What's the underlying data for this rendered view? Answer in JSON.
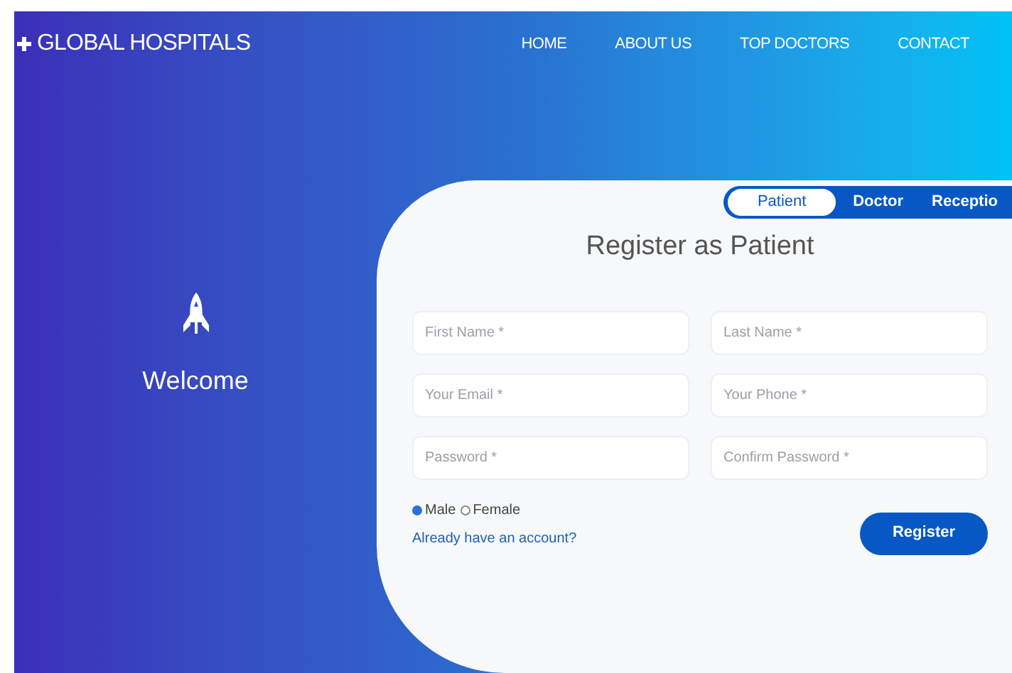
{
  "brand": "GLOBAL HOSPITALS",
  "nav": [
    {
      "label": "HOME"
    },
    {
      "label": "ABOUT US"
    },
    {
      "label": "TOP DOCTORS"
    },
    {
      "label": "CONTACT"
    }
  ],
  "welcome": "Welcome",
  "tabs": [
    {
      "label": "Patient",
      "selected": true
    },
    {
      "label": "Doctor",
      "selected": false
    },
    {
      "label": "Receptio",
      "selected": false
    }
  ],
  "form_title": "Register as Patient",
  "fields": [
    {
      "placeholder": "First Name *"
    },
    {
      "placeholder": "Last Name *"
    },
    {
      "placeholder": "Your Email *"
    },
    {
      "placeholder": "Your Phone *"
    },
    {
      "placeholder": "Password *"
    },
    {
      "placeholder": "Confirm Password *"
    }
  ],
  "gender": [
    {
      "label": "Male",
      "selected": true
    },
    {
      "label": "Female",
      "selected": false
    }
  ],
  "login_link": "Already have an account?",
  "submit": "Register"
}
